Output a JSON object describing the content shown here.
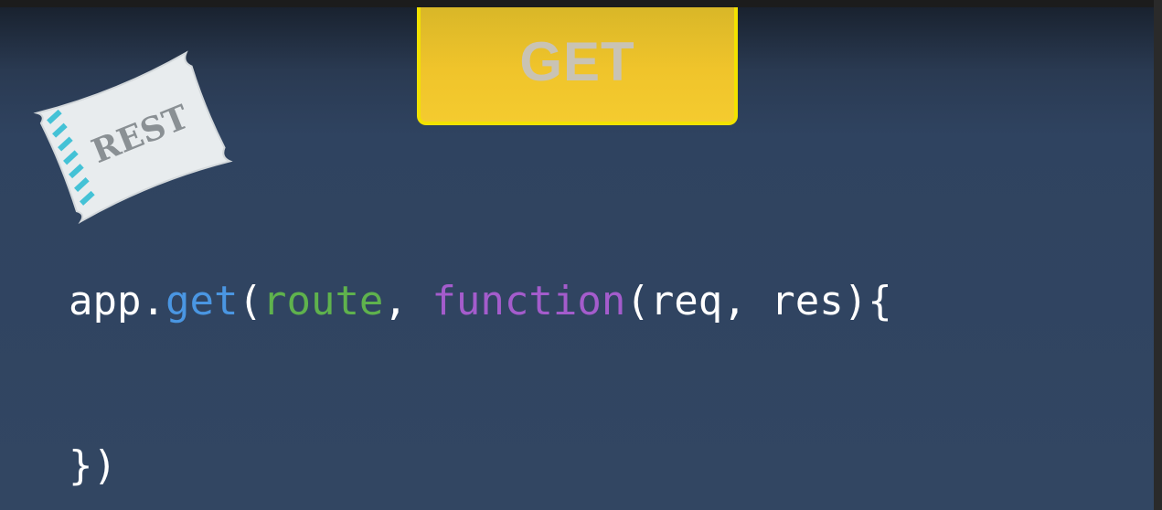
{
  "method_badge": {
    "label": "GET",
    "colors": {
      "fill": "#f0c42b",
      "border": "#f2e200",
      "text": "#c9c3b4"
    }
  },
  "rest_pillow": {
    "label": "REST",
    "icon": "rest-pillow-icon",
    "colors": {
      "fill": "#e8ecee",
      "stripes": "#44c2d6",
      "text": "#8a9094"
    }
  },
  "code": {
    "line1": {
      "object": "app",
      "dot": ".",
      "method": "get",
      "open_paren": "(",
      "arg1": "route",
      "comma": ", ",
      "keyword": "function",
      "params": "(req, res){"
    },
    "line2": {
      "closing": "})"
    },
    "colors": {
      "plain": "#ffffff",
      "method": "#4a96e2",
      "argument": "#5fb24d",
      "keyword": "#a45ccc"
    }
  },
  "background": {
    "top": "#19222f",
    "main": "#324662"
  }
}
